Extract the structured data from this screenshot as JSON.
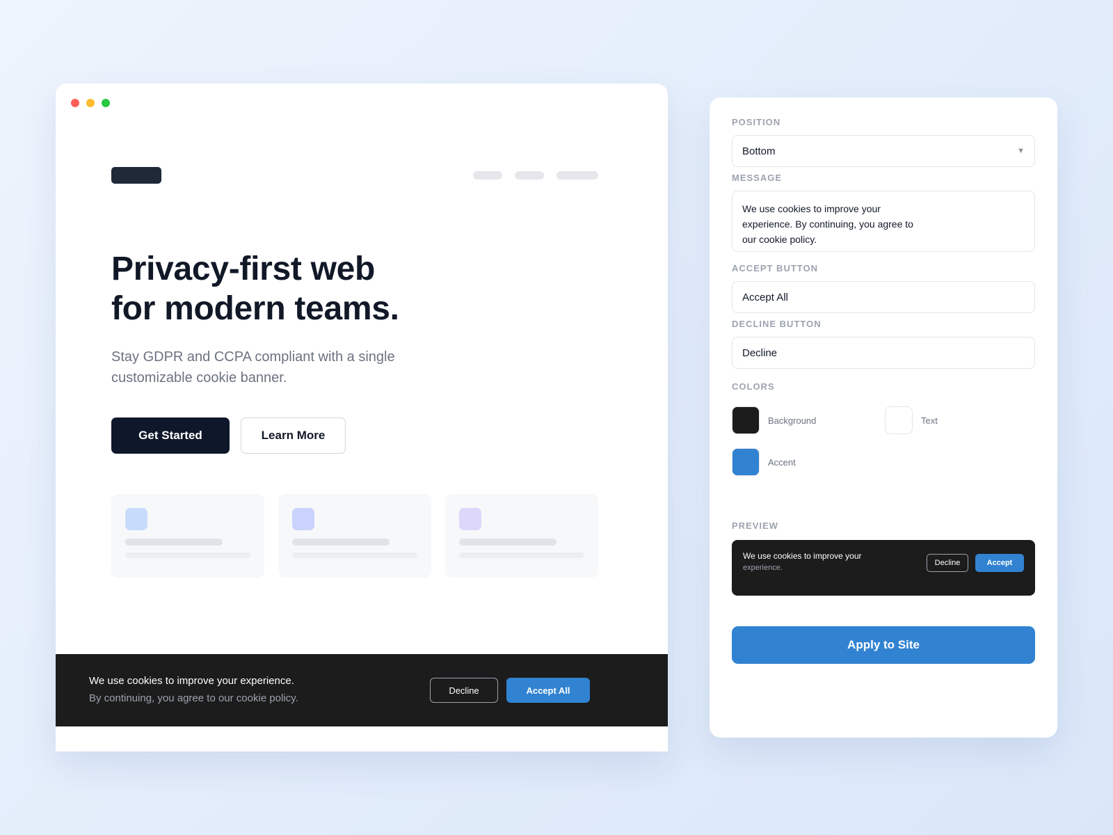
{
  "site": {
    "hero": {
      "title_line1": "Privacy-first web",
      "title_line2": "for modern teams.",
      "subtitle_line1": "Stay GDPR and CCPA compliant with a single",
      "subtitle_line2": "customizable cookie banner."
    },
    "buttons": {
      "get_started": "Get Started",
      "learn_more": "Learn More"
    },
    "cards": [
      {
        "icon_color": "#c7dcfb"
      },
      {
        "icon_color": "#c9d3fb"
      },
      {
        "icon_color": "#ddd7fb"
      }
    ],
    "cookie_banner": {
      "line1": "We use cookies to improve your experience.",
      "line2": "By continuing, you agree to our cookie policy.",
      "decline": "Decline",
      "accept": "Accept All"
    }
  },
  "panel": {
    "position": {
      "label": "POSITION",
      "value": "Bottom"
    },
    "message": {
      "label": "MESSAGE",
      "value": "We use cookies to improve your experience. By continuing, you agree to our cookie policy."
    },
    "accept_button": {
      "label": "ACCEPT BUTTON",
      "value": "Accept All"
    },
    "decline_button": {
      "label": "DECLINE BUTTON",
      "value": "Decline"
    },
    "colors": {
      "label": "COLORS",
      "items": [
        {
          "label": "Background",
          "value": "#1c1c1c"
        },
        {
          "label": "Text",
          "value": "#ffffff"
        },
        {
          "label": "Accent",
          "value": "#3183d2"
        }
      ]
    },
    "preview": {
      "label": "PREVIEW",
      "line1": "We use cookies to improve your",
      "line2": "experience.",
      "decline": "Decline",
      "accept": "Accept"
    },
    "apply": "Apply to Site"
  }
}
